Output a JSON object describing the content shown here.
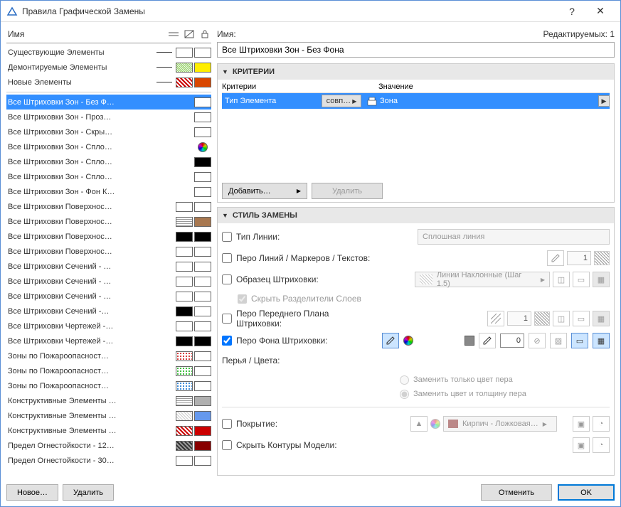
{
  "window": {
    "title": "Правила Графической Замены"
  },
  "left": {
    "header_name": "Имя",
    "rules": [
      {
        "name": "Существующие Элементы",
        "line": true,
        "sw1": "#ffffff",
        "sw2": "#ffffff"
      },
      {
        "name": "Демонтируемые Элементы",
        "line": true,
        "sw1": "diag-grn",
        "sw2": "#ffee00"
      },
      {
        "name": "Новые Элементы",
        "line": true,
        "sw1": "diag",
        "sw2": "#d94700"
      }
    ],
    "rules2": [
      {
        "name": "Все Штриховки Зон - Без Ф…",
        "sw2": "#ffffff",
        "selected": true
      },
      {
        "name": "Все Штриховки Зон - Проз…",
        "sw2": "#ffffff"
      },
      {
        "name": "Все Штриховки Зон - Скры…",
        "sw2": "#ffffff"
      },
      {
        "name": "Все Штриховки Зон - Спло…",
        "sw2": "pie"
      },
      {
        "name": "Все Штриховки Зон - Спло…",
        "sw2": "#000000"
      },
      {
        "name": "Все Штриховки Зон - Спло…",
        "sw2": "#ffffff"
      },
      {
        "name": "Все Штриховки Зон - Фон К…",
        "sw2": "#ffffff"
      },
      {
        "name": "Все Штриховки Поверхнос…",
        "sw1": "#ffffff",
        "sw2": "#ffffff"
      },
      {
        "name": "Все Штриховки Поверхнос…",
        "sw1": "hatch-g",
        "sw2": "#a87850"
      },
      {
        "name": "Все Штриховки Поверхнос…",
        "sw1": "#000000",
        "sw2": "#000000"
      },
      {
        "name": "Все Штриховки Поверхнос…",
        "sw1": "#ffffff",
        "sw2": "#ffffff"
      },
      {
        "name": "Все Штриховки Сечений - …",
        "sw1": "#ffffff",
        "sw2": "#ffffff"
      },
      {
        "name": "Все Штриховки Сечений - …",
        "sw1": "#ffffff",
        "sw2": "#ffffff"
      },
      {
        "name": "Все Штриховки Сечений - …",
        "sw1": "#ffffff",
        "sw2": "#ffffff"
      },
      {
        "name": "Все Штриховки Сечений -…",
        "sw1": "#000000",
        "sw2": "#ffffff"
      },
      {
        "name": "Все Штриховки Чертежей -…",
        "sw1": "#ffffff",
        "sw2": "#ffffff"
      },
      {
        "name": "Все Штриховки Чертежей -…",
        "sw1": "#000000",
        "sw2": "#000000"
      },
      {
        "name": "Зоны по Пожароопасност…",
        "sw1": "dots-r",
        "sw2": "#ffffff"
      },
      {
        "name": "Зоны по Пожароопасност…",
        "sw1": "dots-g",
        "sw2": "#ffffff"
      },
      {
        "name": "Зоны по Пожароопасност…",
        "sw1": "dots-b",
        "sw2": "#ffffff"
      },
      {
        "name": "Конструктивные Элементы …",
        "sw1": "hatch-g",
        "sw2": "#b0b0b0"
      },
      {
        "name": "Конструктивные Элементы …",
        "sw1": "hatch-w",
        "sw2": "#6699ee"
      },
      {
        "name": "Конструктивные Элементы …",
        "sw1": "diag",
        "sw2": "#cc0000"
      },
      {
        "name": "Предел Огнестойкости - 12…",
        "sw1": "diag-dk",
        "sw2": "#880000"
      },
      {
        "name": "Предел Огнестойкости - 30…",
        "sw1": "#ffffff",
        "sw2": "#ffffff"
      }
    ],
    "btn_new": "Новое…",
    "btn_delete": "Удалить"
  },
  "right": {
    "name_label": "Имя:",
    "editable_label": "Редактируемых: 1",
    "name_value": "Все Штриховки Зон - Без Фона",
    "sec_criteria": "КРИТЕРИИ",
    "crit_h1": "Критерии",
    "crit_h2": "Значение",
    "crit_row_type": "Тип Элемента",
    "crit_row_op": "совп…",
    "crit_row_val": "Зона",
    "btn_add": "Добавить…",
    "btn_del": "Удалить",
    "sec_style": "СТИЛЬ ЗАМЕНЫ",
    "s_linetype": "Тип Линии:",
    "dd_linetype": "Сплошная линия",
    "s_linepen": "Перо Линий / Маркеров / Текстов:",
    "s_linepen_num": "1",
    "s_fillpattern": "Образец Штриховки:",
    "dd_fillpattern": "Линии Наклонные (Шаг 1.5)",
    "s_hidelayers": "Скрыть Разделители Слоев",
    "s_fgfill": "Перо Переднего Плана Штриховки:",
    "s_fgfill_num": "1",
    "s_bgfill": "Перо Фона Штриховки:",
    "s_bgfill_num": "0",
    "pens_label": "Перья / Цвета:",
    "radio1": "Заменить только цвет пера",
    "radio2": "Заменить цвет и толщину пера",
    "s_surface": "Покрытие:",
    "dd_surface": "Кирпич - Ложковая…",
    "s_hidecontours": "Скрыть Контуры Модели:"
  },
  "footer": {
    "cancel": "Отменить",
    "ok": "OK"
  }
}
